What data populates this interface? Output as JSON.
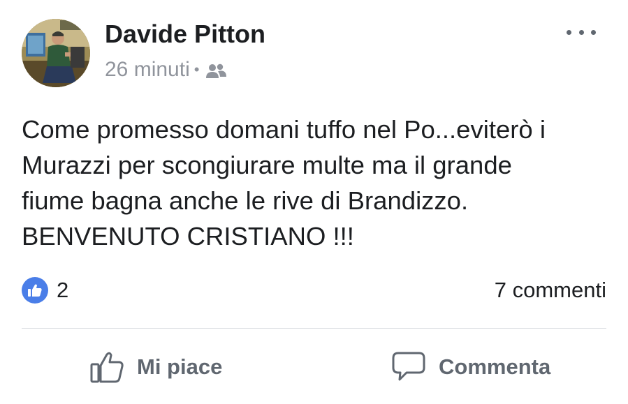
{
  "post": {
    "author": "Davide Pitton",
    "time": "26 minuti",
    "separator": "•",
    "audience_icon": "friends-icon",
    "more_icon": "more-options-icon",
    "body_lines": [
      "Come promesso domani tuffo nel Po...eviterò i",
      "Murazzi per scongiurare multe ma il grande",
      "fiume bagna anche le rive di Brandizzo.",
      "BENVENUTO CRISTIANO !!!"
    ]
  },
  "reactions": {
    "like_count": "2",
    "comments_label": "7 commenti"
  },
  "actions": {
    "like_label": "Mi piace",
    "comment_label": "Commenta"
  },
  "colors": {
    "like_blue": "#4a7ee8",
    "meta_gray": "#90949c",
    "action_gray": "#606770"
  }
}
